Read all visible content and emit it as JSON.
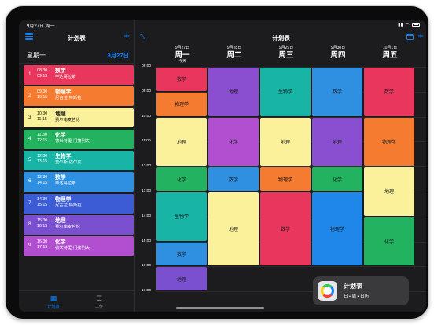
{
  "status": {
    "time": "9月27日 周一"
  },
  "sidebar": {
    "title": "计划表",
    "weekday": "星期一",
    "date": "9月27日",
    "lessons": [
      {
        "num": "1",
        "start": "08:30",
        "end": "09:15",
        "subject": "数学",
        "teacher": "毕达哥拉斯",
        "color": "#e8365d",
        "text": "light"
      },
      {
        "num": "2",
        "start": "09:30",
        "end": "10:15",
        "subject": "物理学",
        "teacher": "尼古拉·特斯拉",
        "color": "#f47b30",
        "text": "light"
      },
      {
        "num": "3",
        "start": "10:30",
        "end": "11:15",
        "subject": "地理",
        "teacher": "费尔南麦哲伦",
        "color": "#fbf19a",
        "text": "dark"
      },
      {
        "num": "4",
        "start": "11:30",
        "end": "12:15",
        "subject": "化学",
        "teacher": "德米特里·门捷列夫",
        "color": "#23b25f",
        "text": "light"
      },
      {
        "num": "5",
        "start": "12:30",
        "end": "13:15",
        "subject": "生物学",
        "teacher": "查尔斯·达尔文",
        "color": "#18b4a6",
        "text": "light"
      },
      {
        "num": "6",
        "start": "13:30",
        "end": "14:15",
        "subject": "数学",
        "teacher": "毕达哥拉斯",
        "color": "#2f8fe0",
        "text": "light"
      },
      {
        "num": "7",
        "start": "14:30",
        "end": "15:15",
        "subject": "物理学",
        "teacher": "尼古拉·特斯拉",
        "color": "#3c5cd6",
        "text": "light"
      },
      {
        "num": "8",
        "start": "15:30",
        "end": "16:15",
        "subject": "地理",
        "teacher": "费尔南麦哲伦",
        "color": "#7a4fd0",
        "text": "light"
      },
      {
        "num": "9",
        "start": "16:30",
        "end": "17:15",
        "subject": "化学",
        "teacher": "德米特里·门捷列夫",
        "color": "#b14fd0",
        "text": "light"
      }
    ],
    "tabs": [
      {
        "label": "计划表",
        "icon": "grid-icon"
      },
      {
        "label": "工作",
        "icon": "list-icon"
      }
    ]
  },
  "main": {
    "title": "计划表",
    "days": [
      {
        "date": "9月27日",
        "name": "周一",
        "today": "今天"
      },
      {
        "date": "9月28日",
        "name": "周二",
        "today": ""
      },
      {
        "date": "9月29日",
        "name": "周三",
        "today": ""
      },
      {
        "date": "9月30日",
        "name": "周四",
        "today": ""
      },
      {
        "date": "10月1日",
        "name": "周五",
        "today": ""
      }
    ],
    "times": [
      "08:00",
      "09:00",
      "10:00",
      "11:00",
      "12:00",
      "13:00",
      "14:00",
      "15:00",
      "16:00",
      "17:00"
    ],
    "blocks": [
      {
        "day": 0,
        "start": 8.0,
        "end": 9.0,
        "label": "数学",
        "color": "#e8365d",
        "text": "dark"
      },
      {
        "day": 0,
        "start": 9.0,
        "end": 10.0,
        "label": "物理学",
        "color": "#f47b30",
        "text": "dark"
      },
      {
        "day": 0,
        "start": 10.0,
        "end": 12.0,
        "label": "地理",
        "color": "#fbf19a",
        "text": "dark"
      },
      {
        "day": 0,
        "start": 12.0,
        "end": 13.0,
        "label": "化学",
        "color": "#23b25f",
        "text": "dark"
      },
      {
        "day": 0,
        "start": 13.0,
        "end": 15.0,
        "label": "生物学",
        "color": "#18b4a6",
        "text": "dark"
      },
      {
        "day": 0,
        "start": 15.0,
        "end": 16.0,
        "label": "数学",
        "color": "#2f8fe0",
        "text": "dark"
      },
      {
        "day": 0,
        "start": 16.0,
        "end": 17.0,
        "label": "地理",
        "color": "#7a4fd0",
        "text": "dark"
      },
      {
        "day": 1,
        "start": 8.0,
        "end": 10.0,
        "label": "地理",
        "color": "#8a4fd0",
        "text": "dark"
      },
      {
        "day": 1,
        "start": 10.0,
        "end": 12.0,
        "label": "化学",
        "color": "#b14fd0",
        "text": "dark"
      },
      {
        "day": 1,
        "start": 12.0,
        "end": 13.0,
        "label": "数学",
        "color": "#2f8fe0",
        "text": "dark"
      },
      {
        "day": 1,
        "start": 13.0,
        "end": 16.0,
        "label": "地理",
        "color": "#fbf19a",
        "text": "dark"
      },
      {
        "day": 2,
        "start": 8.0,
        "end": 10.0,
        "label": "生物学",
        "color": "#18b4a6",
        "text": "dark"
      },
      {
        "day": 2,
        "start": 10.0,
        "end": 12.0,
        "label": "地理",
        "color": "#fbf19a",
        "text": "dark"
      },
      {
        "day": 2,
        "start": 12.0,
        "end": 13.0,
        "label": "物理学",
        "color": "#f47b30",
        "text": "dark"
      },
      {
        "day": 2,
        "start": 13.0,
        "end": 16.0,
        "label": "数学",
        "color": "#e8365d",
        "text": "dark"
      },
      {
        "day": 3,
        "start": 8.0,
        "end": 10.0,
        "label": "数学",
        "color": "#2f8fe0",
        "text": "dark"
      },
      {
        "day": 3,
        "start": 10.0,
        "end": 12.0,
        "label": "地理",
        "color": "#8a4fd0",
        "text": "dark"
      },
      {
        "day": 3,
        "start": 12.0,
        "end": 13.0,
        "label": "化学",
        "color": "#23b25f",
        "text": "dark"
      },
      {
        "day": 3,
        "start": 13.0,
        "end": 16.0,
        "label": "物理学",
        "color": "#1f86ea",
        "text": "dark"
      },
      {
        "day": 4,
        "start": 8.0,
        "end": 10.0,
        "label": "数学",
        "color": "#e8365d",
        "text": "dark"
      },
      {
        "day": 4,
        "start": 10.0,
        "end": 12.0,
        "label": "物理学",
        "color": "#f47b30",
        "text": "dark"
      },
      {
        "day": 4,
        "start": 12.0,
        "end": 14.0,
        "label": "地理",
        "color": "#fbf19a",
        "text": "dark"
      },
      {
        "day": 4,
        "start": 14.0,
        "end": 16.0,
        "label": "化学",
        "color": "#23b25f",
        "text": "dark"
      }
    ]
  },
  "widget": {
    "title": "计划表",
    "subtitle": "日 • 周 • 日历"
  }
}
